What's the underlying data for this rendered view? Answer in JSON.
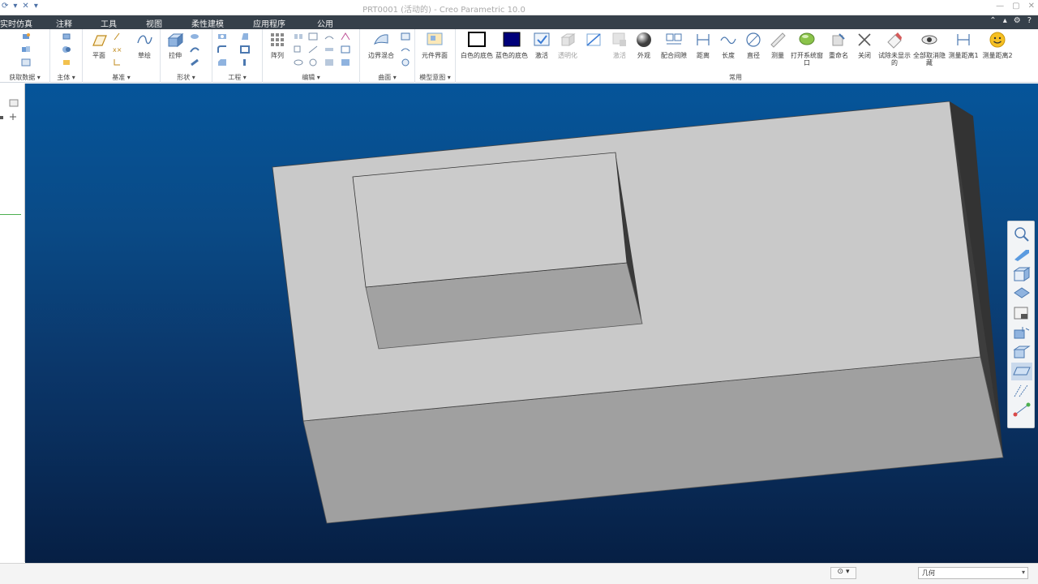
{
  "window": {
    "title": "PRT0001 (活动的) - Creo Parametric 10.0"
  },
  "quick_access": {
    "redo_symbol": "⟳",
    "dropdown_symbol": "▾",
    "close_symbol": "✕"
  },
  "menu": {
    "tabs": [
      {
        "label": "实时仿真"
      },
      {
        "label": "注释"
      },
      {
        "label": "工具"
      },
      {
        "label": "视图"
      },
      {
        "label": "柔性建模"
      },
      {
        "label": "应用程序"
      },
      {
        "label": "公用"
      }
    ]
  },
  "ribbon": {
    "groups": {
      "get_data": "获取数据",
      "body": "主体",
      "datum": "基准",
      "shapes": "形状",
      "engineering": "工程",
      "editing": "编辑",
      "surfaces": "曲面",
      "model_intent": "模型意图",
      "common": "常用"
    },
    "tools": {
      "plane": "平面",
      "sketch": "草绘",
      "extrude": "拉伸",
      "pattern": "阵列",
      "boundary_blend": "边界混合",
      "component_interface": "元件界面",
      "white_bg": "白色的底色",
      "blue_bg": "蓝色的底色",
      "activate": "激活",
      "transparent": "透明化",
      "activate2": "激活",
      "appearance": "外观",
      "mate_gap": "配合间隙",
      "distance": "距离",
      "length": "长度",
      "diameter": "直径",
      "measure": "测量",
      "open_sys_window": "打开系统窗口",
      "rename": "重命名",
      "close": "关闭",
      "try_hidden": "试除未显示的",
      "cancel_hide_all": "全部取消隐藏",
      "measure_dist_1": "测量距离1",
      "measure_dist_2": "测量距离2"
    }
  },
  "status": {
    "selection_filter": "几何"
  },
  "colors": {
    "menu_bg": "#36404a",
    "viewport_top": "#05559a",
    "viewport_bottom": "#061f44",
    "blue_bg_swatch": "#00007a",
    "face_top": "#c9c9c9",
    "face_front": "#a0a0a0",
    "face_side": "#3a3a3a"
  }
}
